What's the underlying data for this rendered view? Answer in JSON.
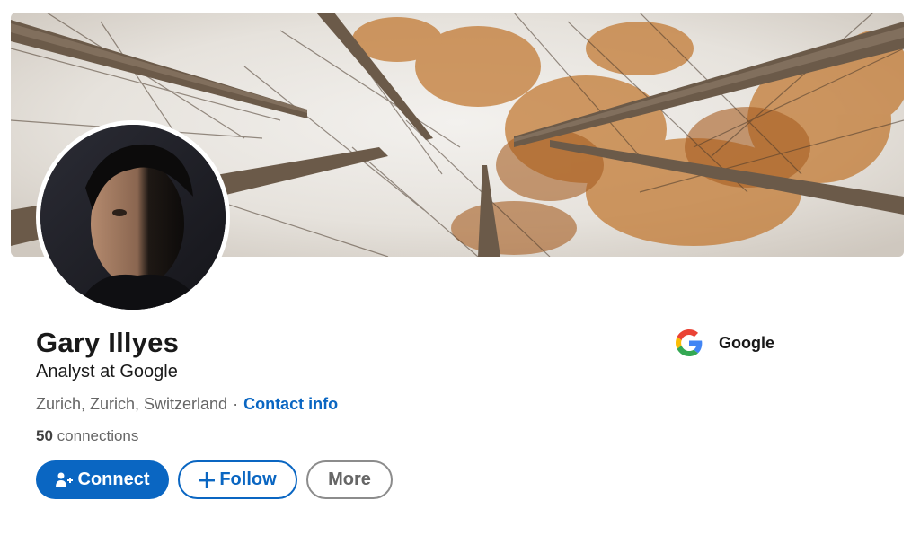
{
  "profile": {
    "name": "Gary Illyes",
    "headline": "Analyst at Google",
    "location": "Zurich, Zurich, Switzerland",
    "separator": "·",
    "contact_info_label": "Contact info",
    "connections_count": "50",
    "connections_label": "connections"
  },
  "actions": {
    "connect_label": "Connect",
    "follow_label": "Follow",
    "more_label": "More"
  },
  "company": {
    "name": "Google",
    "logo_icon": "google-g-icon"
  },
  "colors": {
    "accent": "#0a66c2",
    "secondary_text": "#666666"
  }
}
